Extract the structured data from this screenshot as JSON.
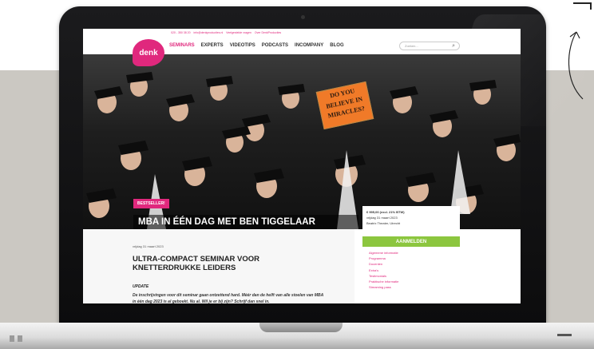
{
  "topbar": {
    "phone": "020 - 350 38 20",
    "email": "info@denkproducties.nl",
    "faq": "Veelgestelde vragen",
    "about": "Over DenkProducties"
  },
  "brand": {
    "logo": "denk",
    "accent": "#e0287d",
    "green": "#8cc63f"
  },
  "nav": {
    "items": [
      "SEMINARS",
      "EXPERTS",
      "VIDEOTIPS",
      "PODCASTS",
      "INCOMPANY",
      "BLOG"
    ],
    "active_index": 0
  },
  "search": {
    "placeholder": "Zoeken..."
  },
  "hero": {
    "sign_text": "DO YOU BELIEVE IN MIRACLES?",
    "badge": "BESTSELLER!",
    "title": "MBA IN ÉÉN DAG MET BEN TIGGELAAR"
  },
  "event_card": {
    "price": "€ 995,00 (excl. 21% BTW)",
    "date": "vrijdag 31 maart 2023",
    "venue": "Beatrix Theater, Utrecht",
    "cta": "AANMELDEN"
  },
  "side_links": [
    "Algemene informatie",
    "Programma",
    "Docenten",
    "Extra's",
    "Testimonials",
    "Praktische informatie",
    "Streaming pass"
  ],
  "article": {
    "date": "vrijdag 31 maart 2023",
    "title": "ULTRA-COMPACT SEMINAR VOOR KNETTERDRUKKE LEIDERS",
    "update_heading": "UPDATE",
    "update_text": "De inschrijvingen voor dit seminar gaan ontzettend hard. Méér dan de helft van alle stoelen van MBA in één dag 2023 is al geboekt. Nu al. Wil je er bij zijn? Schrijf dan snel in."
  }
}
